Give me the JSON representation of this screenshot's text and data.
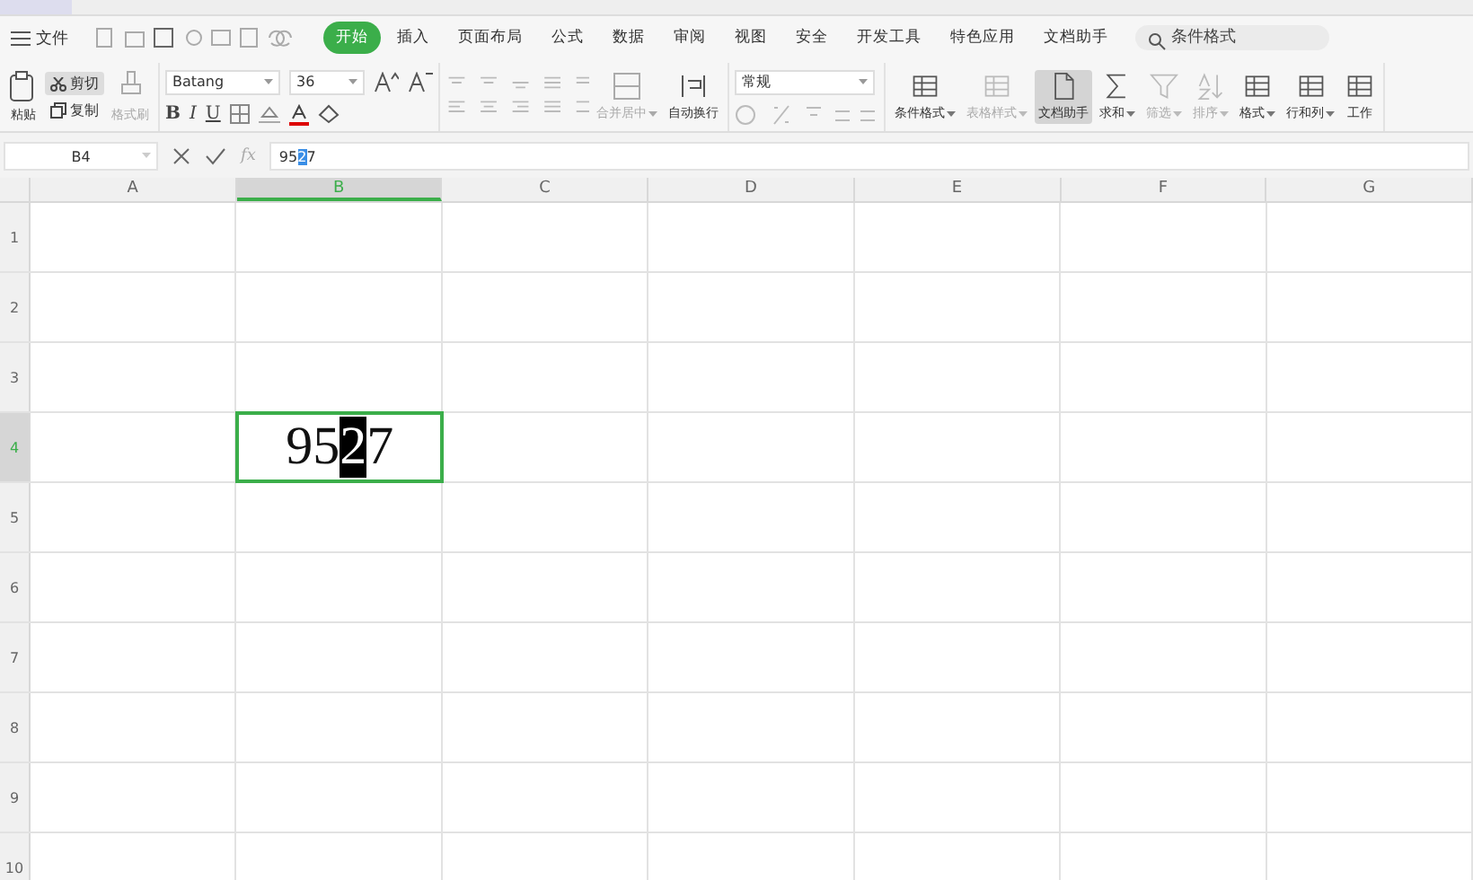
{
  "menu": {
    "file_label": "文件",
    "items": [
      {
        "label": "开始",
        "selected": true
      },
      {
        "label": "插入",
        "selected": false
      },
      {
        "label": "页面布局",
        "selected": false
      },
      {
        "label": "公式",
        "selected": false
      },
      {
        "label": "数据",
        "selected": false
      },
      {
        "label": "审阅",
        "selected": false
      },
      {
        "label": "视图",
        "selected": false
      },
      {
        "label": "安全",
        "selected": false
      },
      {
        "label": "开发工具",
        "selected": false
      },
      {
        "label": "特色应用",
        "selected": false
      },
      {
        "label": "文档助手",
        "selected": false
      }
    ],
    "search": {
      "placeholder": "条件格式"
    }
  },
  "ribbon": {
    "paste": "粘贴",
    "cut": "剪切",
    "copy": "复制",
    "format_painter": {
      "label": "格式刷",
      "disabled": true
    },
    "format_buttons": [
      "B",
      "I",
      "U"
    ],
    "font": "Batang",
    "size": "36",
    "merge": {
      "label": "合并居中",
      "disabled": true
    },
    "wrap": "自动换行",
    "number_format": "常规",
    "buttons": [
      {
        "kind": "grid",
        "label": "条件格式",
        "disabled": false,
        "selected": false,
        "dropdown": true
      },
      {
        "kind": "grid",
        "label": "表格样式",
        "disabled": true,
        "selected": false,
        "dropdown": true
      },
      {
        "kind": "doc",
        "label": "文档助手",
        "disabled": false,
        "selected": true,
        "dropdown": false
      },
      {
        "kind": "sum",
        "label": "求和",
        "disabled": false,
        "selected": false,
        "dropdown": true
      },
      {
        "kind": "filter",
        "label": "筛选",
        "disabled": true,
        "selected": false,
        "dropdown": true
      },
      {
        "kind": "sort",
        "label": "排序",
        "disabled": true,
        "selected": false,
        "dropdown": true
      },
      {
        "kind": "grid",
        "label": "格式",
        "disabled": false,
        "selected": false,
        "dropdown": true
      },
      {
        "kind": "grid",
        "label": "行和列",
        "disabled": false,
        "selected": false,
        "dropdown": true
      },
      {
        "kind": "grid",
        "label": "工作",
        "disabled": false,
        "selected": false,
        "dropdown": false
      }
    ]
  },
  "formula_bar": {
    "name_box": "B4",
    "fx": "fx",
    "parts": [
      {
        "text": "95",
        "selected": false
      },
      {
        "text": "2",
        "selected": true
      },
      {
        "text": "7",
        "selected": false
      }
    ]
  },
  "columns": [
    {
      "label": "A",
      "selected": false
    },
    {
      "label": "B",
      "selected": true
    },
    {
      "label": "C",
      "selected": false
    },
    {
      "label": "D",
      "selected": false
    },
    {
      "label": "E",
      "selected": false
    },
    {
      "label": "F",
      "selected": false
    },
    {
      "label": "G",
      "selected": false
    }
  ],
  "rows": [
    {
      "label": "1",
      "selected": false
    },
    {
      "label": "2",
      "selected": false
    },
    {
      "label": "3",
      "selected": false
    },
    {
      "label": "4",
      "selected": true
    },
    {
      "label": "5",
      "selected": false
    },
    {
      "label": "6",
      "selected": false
    },
    {
      "label": "7",
      "selected": false
    },
    {
      "label": "8",
      "selected": false
    },
    {
      "label": "9",
      "selected": false
    },
    {
      "label": "10",
      "selected": false
    }
  ],
  "active_cell": {
    "parts": [
      {
        "text": "95",
        "selected": false
      },
      {
        "text": "2",
        "selected": true
      },
      {
        "text": "7",
        "selected": false
      }
    ]
  }
}
